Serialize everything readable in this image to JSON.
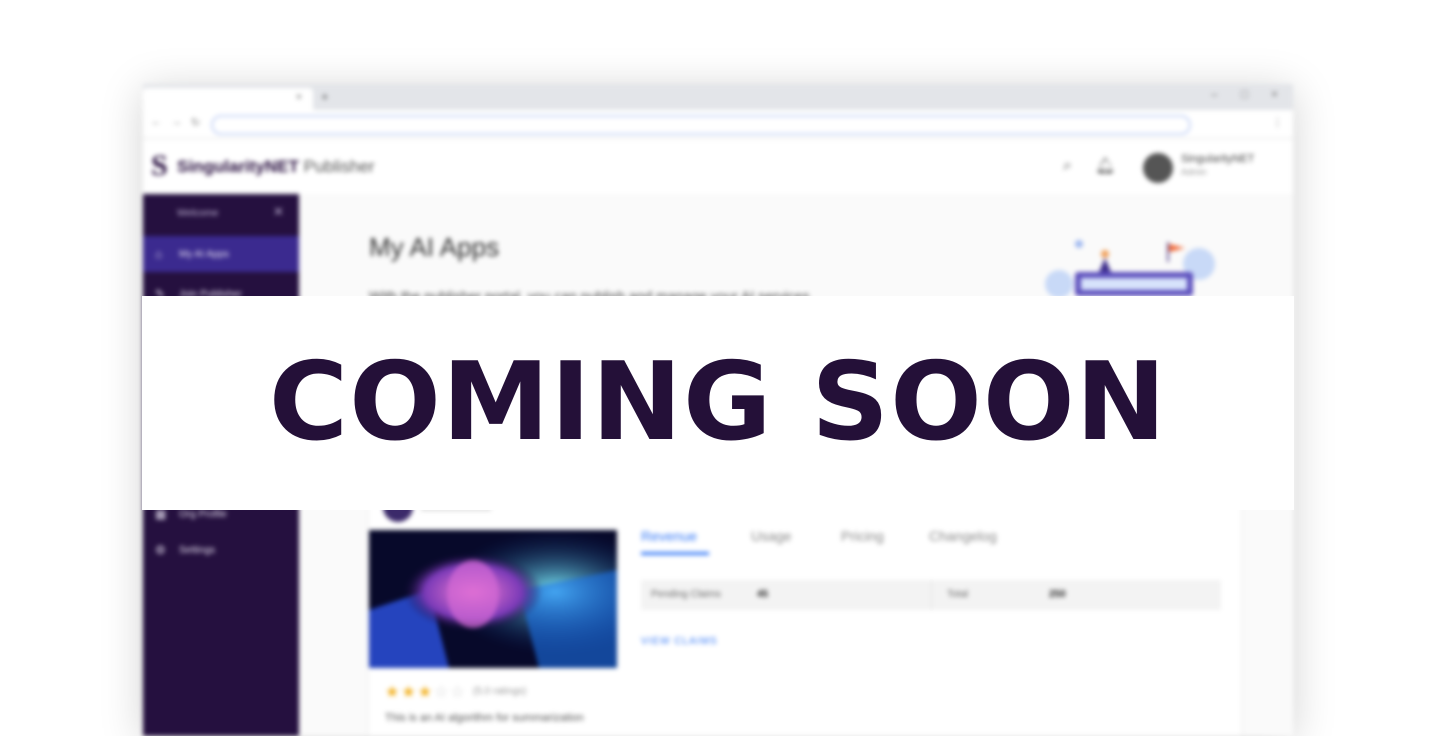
{
  "banner": {
    "text": "COMING SOON"
  },
  "colors": {
    "banner_text": "#241038",
    "sidebar_bg": "#25103f",
    "sidebar_active": "#3b2a8f",
    "accent_blue": "#3478f6",
    "star": "#f2b01e"
  },
  "browser": {
    "tab_close": "×",
    "new_tab": "+",
    "window_controls": [
      "–",
      "□",
      "×"
    ],
    "nav_icons": [
      "back-icon",
      "forward-icon",
      "reload-icon"
    ],
    "menu_icon": "menu-dots-icon"
  },
  "appbar": {
    "logo_mark": "S",
    "logo_name": "SingularityNET",
    "logo_suffix": "Publisher",
    "user_name": "SingularityNET",
    "user_role": "Admin",
    "icons": [
      "search-icon",
      "bell-icon",
      "avatar"
    ]
  },
  "sidebar": {
    "header": "Welcome",
    "items": [
      {
        "label": "My AI Apps",
        "icon": "home-icon",
        "active": true
      },
      {
        "label": "Join Publisher",
        "icon": "edit-icon",
        "active": false
      },
      {
        "label": "Org Profile",
        "icon": "org-icon",
        "active": false
      },
      {
        "label": "Settings",
        "icon": "settings-icon",
        "active": false
      }
    ]
  },
  "main": {
    "title": "My AI Apps",
    "description": "With the publisher portal, you can publish and manage your AI services",
    "card": {
      "rating_stars_filled": 3,
      "rating_stars_total": 5,
      "rating_count": "(5.0 ratings)",
      "description": "This is an AI algorithm for summarization",
      "tabs": [
        "Revenue",
        "Usage",
        "Pricing",
        "Changelog"
      ],
      "active_tab": "Revenue",
      "stats": {
        "pending_label": "Pending Claims",
        "pending_value": "45",
        "total_label": "Total",
        "total_value": "250"
      },
      "view_claims": "VIEW CLAIMS"
    }
  }
}
